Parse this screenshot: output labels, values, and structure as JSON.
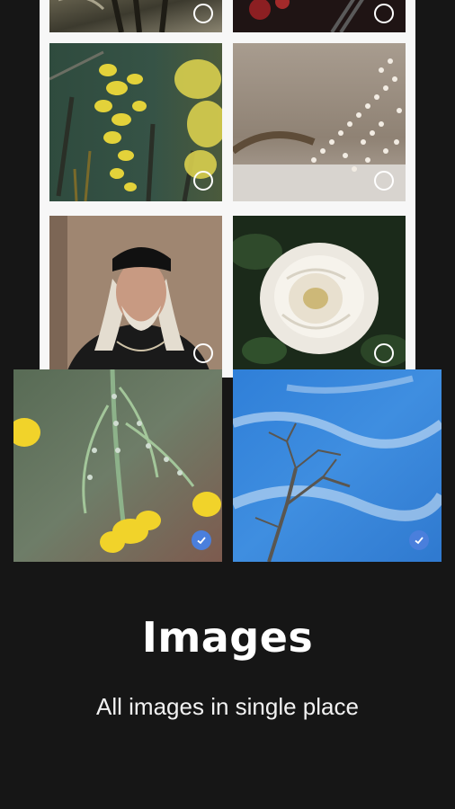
{
  "screen": {
    "title": "Images",
    "subtitle": "All images in single place"
  },
  "gallery": {
    "tiles": [
      {
        "name": "photo-dark-plant",
        "selected": false
      },
      {
        "name": "photo-red-flowers",
        "selected": false
      },
      {
        "name": "photo-yellow-flowers",
        "selected": false
      },
      {
        "name": "photo-dried-flowers",
        "selected": false
      },
      {
        "name": "photo-man-portrait",
        "selected": false
      },
      {
        "name": "photo-white-rose",
        "selected": false
      },
      {
        "name": "photo-yellow-blossom",
        "selected": true
      },
      {
        "name": "photo-blue-sky-tree",
        "selected": true
      }
    ]
  },
  "colors": {
    "background": "#161616",
    "frame": "#f7f7f7",
    "selected_accent": "#4a7fdc"
  }
}
